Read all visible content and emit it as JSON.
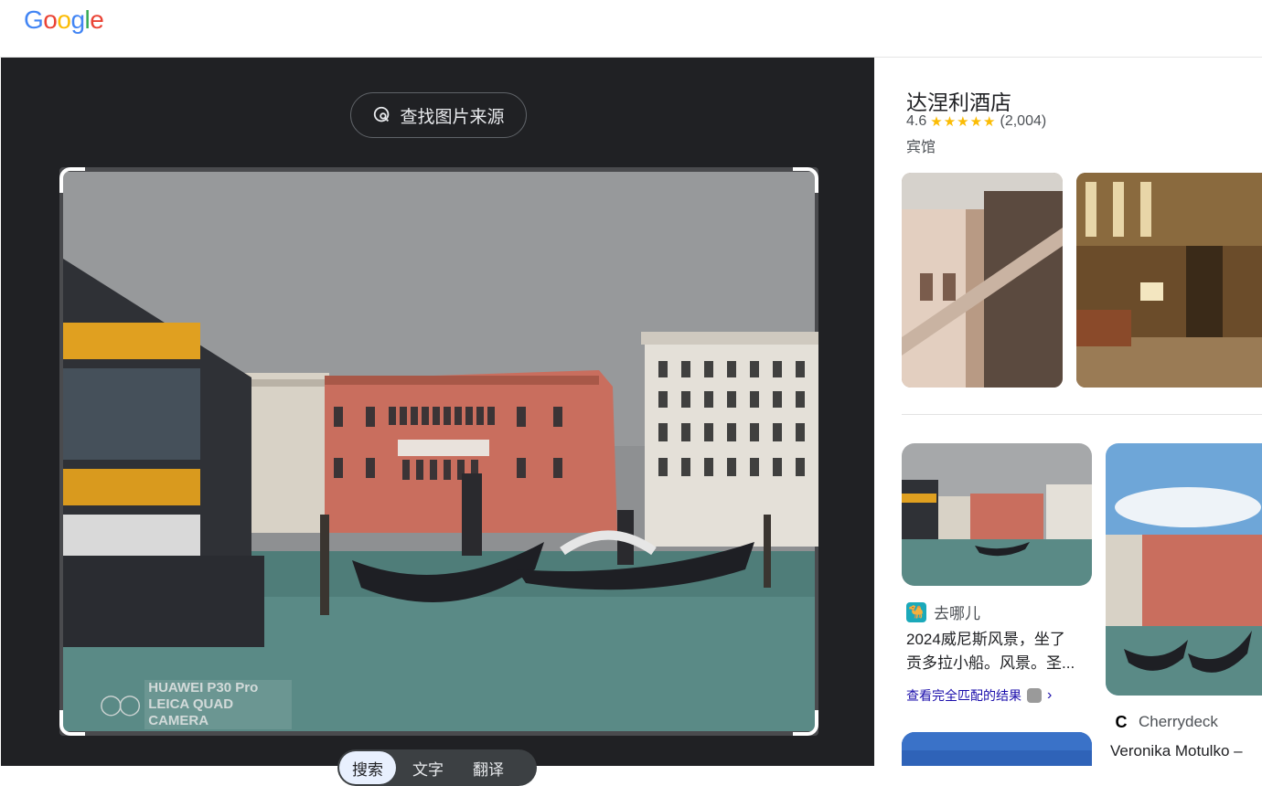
{
  "header": {
    "logo": [
      "G",
      "o",
      "o",
      "g",
      "l",
      "e"
    ],
    "logo_colors": [
      "#4285F4",
      "#EA4335",
      "#FBBC05",
      "#4285F4",
      "#34A853",
      "#EA4335"
    ]
  },
  "viewer": {
    "source_button": "查找图片来源",
    "watermark_line1": "HUAWEI P30 Pro",
    "watermark_line2": "LEICA QUAD CAMERA",
    "modes": [
      "搜索",
      "文字",
      "翻译"
    ],
    "active_mode": "搜索"
  },
  "knowledge": {
    "title": "达涅利酒店",
    "rating": "4.6",
    "stars": "★★★★★",
    "reviews": "(2,004)",
    "type": "宾馆"
  },
  "results": [
    {
      "source": "去哪儿",
      "title_line1": "2024威尼斯风景，坐了",
      "title_line2": "贡多拉小船。风景。圣...",
      "match_label": "查看完全匹配的结果"
    },
    {
      "source": "Cherrydeck",
      "title": "Veronika Motulko –"
    }
  ],
  "colors": {
    "panel_dark": "#202124",
    "accent_star": "#fbbc04",
    "link": "#1a0dab"
  }
}
